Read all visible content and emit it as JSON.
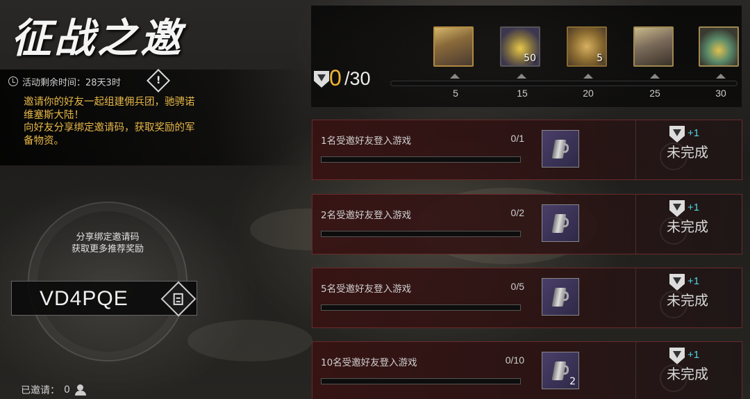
{
  "header": {
    "title": "征战之邀",
    "timer_text": "活动剩余时间：28天3时",
    "description_lines": [
      "邀请你的好友一起组建佣兵团，驰骋诺",
      "维塞斯大陆！",
      "向好友分享绑定邀请码，获取奖励的军",
      "备物资。"
    ]
  },
  "share": {
    "line1": "分享绑定邀请码",
    "line2": "获取更多推荐奖励",
    "code": "VD4PQE",
    "invited_label": "已邀请：",
    "invited_count": "0"
  },
  "progress": {
    "current": "0",
    "max": "/30",
    "rewards": [
      {
        "milestone": "5",
        "qty": "",
        "icon": "hero-portrait-blonde"
      },
      {
        "milestone": "15",
        "qty": "50",
        "icon": "gold-coins-chest"
      },
      {
        "milestone": "20",
        "qty": "5",
        "icon": "gold-medallion"
      },
      {
        "milestone": "25",
        "qty": "",
        "icon": "hero-portrait-silver"
      },
      {
        "milestone": "30",
        "qty": "",
        "icon": "treasure-pile"
      }
    ]
  },
  "tasks": [
    {
      "label": "1名受邀好友登入游戏",
      "count": "0/1",
      "reward_qty": "",
      "points": "+1",
      "status": "未完成"
    },
    {
      "label": "2名受邀好友登入游戏",
      "count": "0/2",
      "reward_qty": "",
      "points": "+1",
      "status": "未完成"
    },
    {
      "label": "5名受邀好友登入游戏",
      "count": "0/5",
      "reward_qty": "",
      "points": "+1",
      "status": "未完成"
    },
    {
      "label": "10名受邀好友登入游戏",
      "count": "0/10",
      "reward_qty": "2",
      "points": "+1",
      "status": "未完成"
    }
  ],
  "colors": {
    "accent_gold": "#f0b432",
    "description_text": "#e8b848",
    "points_plus": "#4fd2e0",
    "task_border": "#6a2a2a"
  }
}
